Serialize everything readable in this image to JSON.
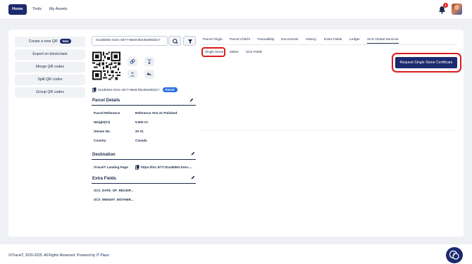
{
  "nav": {
    "items": [
      {
        "label": "Home",
        "active": true
      },
      {
        "label": "Tools",
        "active": false
      },
      {
        "label": "My Assets",
        "active": false
      }
    ],
    "notification_count": "1"
  },
  "sidebar": {
    "buttons": [
      {
        "label": "Create a new QR",
        "badge": "New"
      },
      {
        "label": "Export on blockchain"
      },
      {
        "label": "Merge QR codes"
      },
      {
        "label": "Split QR codes"
      },
      {
        "label": "Group QR codes"
      }
    ]
  },
  "search": {
    "value": "01a3b591-010c-4577-96e8-bbe35e80d217"
  },
  "asset": {
    "uuid": "01a3b591-010c-4577-96e8-bbe35e80d217",
    "type_badge": "Parcel"
  },
  "parcel_details": {
    "title": "Parcel Details",
    "rows": [
      {
        "label": "Parcel Reference",
        "value": "Reference Test 21 Polished"
      },
      {
        "label": "Weight(Ct)",
        "value": "5.600 Ct."
      },
      {
        "label": "Stones No.",
        "value": "20 St."
      },
      {
        "label": "Country",
        "value": "Canada"
      }
    ]
  },
  "destination": {
    "title": "Destination",
    "label": "iTraceiT Landing Page",
    "value": "https://itrc.it/?i=01a3b591-010c-..."
  },
  "extra_fields": {
    "title": "Extra Fields",
    "rows": [
      {
        "label": "SCS_DATE_OF_RECEIP..."
      },
      {
        "label": "SCS_WEIGHT_MOTHER..."
      }
    ]
  },
  "tabs": [
    {
      "label": "Parcel Origin",
      "active": false
    },
    {
      "label": "Parcel Child's",
      "active": false
    },
    {
      "label": "Traceability",
      "active": false
    },
    {
      "label": "Documents",
      "active": false
    },
    {
      "label": "History",
      "active": false
    },
    {
      "label": "Extra Fields",
      "active": false
    },
    {
      "label": "Ledger",
      "active": false
    },
    {
      "label": "SCS Global Services",
      "active": true
    }
  ],
  "subtabs": [
    {
      "label": "Single Stone",
      "active": true
    },
    {
      "label": "Melee",
      "active": false
    },
    {
      "label": "SCS Fields",
      "active": false
    }
  ],
  "request_button": {
    "label": "Request Single Stone Certificate"
  },
  "footer": {
    "text": "©iTraceiT, 2020-2025. All Rights Reserved. Powered by ",
    "link": "IT Place"
  },
  "colors": {
    "primary": "#1c2a6e",
    "accent_blue": "#2a6ee6",
    "annotation_red": "#d91c1c",
    "notification_red": "#e02424"
  },
  "icons": {
    "search": "search-icon",
    "filter": "filter-icon",
    "bell": "bell-icon",
    "edit": "pencil-icon",
    "copy": "copy-icon",
    "chat": "chat-support-icon"
  }
}
